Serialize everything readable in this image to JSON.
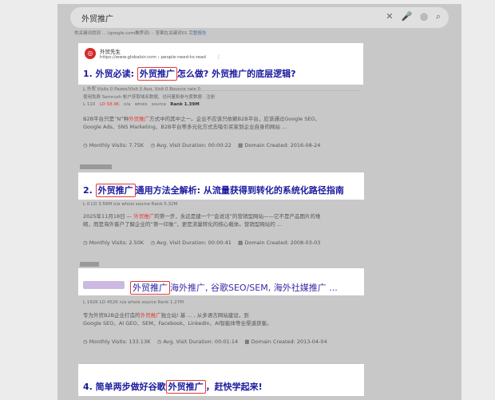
{
  "search": {
    "query": "外贸推广"
  },
  "note": {
    "text": "你关键词找到 ... (google.com推荐词) ·· 答案在关键词01 ",
    "link": "完整报告"
  },
  "result1": {
    "site_name": "外贸先生",
    "url": "https://www.globalsir.com › people-need-to-read",
    "menu": "⋮",
    "title_pre": "1. 外贸必读: ",
    "title_hl": "外贸推广",
    "title_post": "怎么做? 外贸推广的底层逻辑?",
    "metrics1": "L 外贸   Visits 0   Pages/Visit 0   Avg. Visit 0   Bounce rate 0",
    "metrics2": "使用免费 Semrush 帐户获取域名数据、访问量和参与度数据 · 注册",
    "metrics3a": "L 110",
    "metrics3b": "LD 58.9K",
    "metrics3c": "n/a",
    "metrics3d": "whois",
    "metrics3e": "source",
    "metrics3f": "Rank 1.39M",
    "body1": "B2B平台只是“N”种",
    "body1_red": "外贸推广",
    "body1_post": "方式中的其中之一。企业不应该只依赖B2B平台，应该通过Google SEO、",
    "body2": "Google Ads、SNS Marketing、B2B平台等多元化方式去吸引买家到企业自身的网站 ...",
    "stats": {
      "visits": "Monthly Visits: 7.75K",
      "duration": "Avg. Visit Duration: 00:00:22",
      "domain": "Domain Created: 2016-08-24"
    }
  },
  "result2": {
    "title_pre": "2. ",
    "title_hl": "外贸推广",
    "title_post": "通用方法全解析: 从流量获得到转化的系统化路径指南",
    "metrics": "L 0   LD 3.56M   n/a   whois   source   Rank 5.32M",
    "body1": "2025年11月18日 — ",
    "body1_red": "外贸推广",
    "body1_post": "的第一步，永远是建一个“会说话”的营销型网站——它不是产品图片的堆",
    "body2": "砌，而是海外客户了解企业的“第一印象”，更是流量转化的核心载体。营销型网站的 ...",
    "stats": {
      "visits": "Monthly Visits: 2.50K",
      "duration": "Avg. Visit Duration: 00:00:41",
      "domain": "Domain Created: 2008-03-03"
    }
  },
  "result3": {
    "title_hl": "外贸推广",
    "title_post": "海外推广, 谷歌SEO/SEM, 海外社媒推广 ...",
    "metrics": "L 192K   LD 452K   n/a   whois   source   Rank 1.27M",
    "body1": "专为外贸B2B企业打造的",
    "body1_red": "外贸推广",
    "body1_post": "独立站! 基 ...                    , 从多语言网站建设，到",
    "body2": "Google SEO、AI GEO、SEM、Facebook、LinkedIn、AI智能体等全渠道获客。",
    "stats": {
      "visits": "Monthly Visits: 133.13K",
      "duration": "Avg. Visit Duration: 00:01:14",
      "domain": "Domain Created: 2013-04-04"
    }
  },
  "result4": {
    "title_pre": "4. 简单两步做好谷歌",
    "title_hl": "外贸推广",
    "title_post": "，赶快学起来!"
  },
  "colors": {
    "title": "#1a1a9f",
    "highlight": "#e53935"
  }
}
